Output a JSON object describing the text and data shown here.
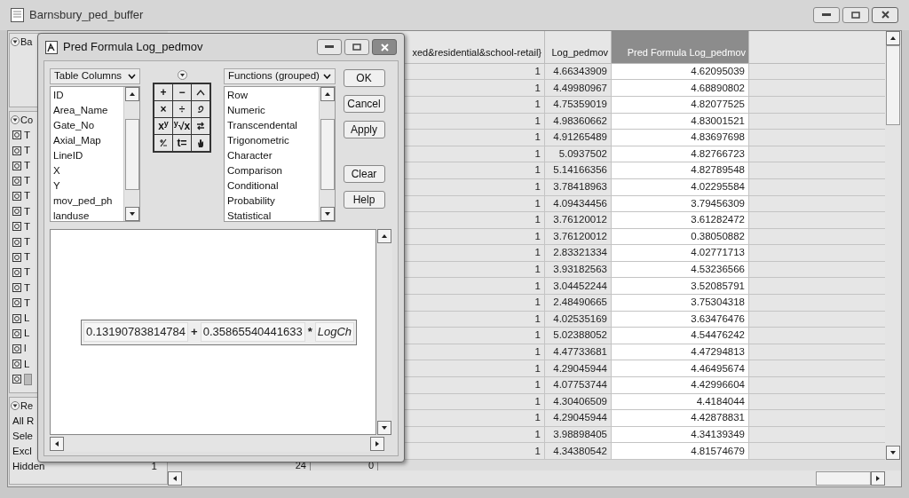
{
  "window": {
    "title": "Barnsbury_ped_buffer"
  },
  "left_panel": {
    "sections": [
      {
        "label": "Ba"
      },
      {
        "label": "Co"
      },
      {
        "label": "Re"
      }
    ],
    "columns": [
      {
        "label": "T"
      },
      {
        "label": "T"
      },
      {
        "label": "T"
      },
      {
        "label": "T"
      },
      {
        "label": "T"
      },
      {
        "label": "T"
      },
      {
        "label": "T"
      },
      {
        "label": "T"
      },
      {
        "label": "T"
      },
      {
        "label": "T"
      },
      {
        "label": "T"
      },
      {
        "label": "T"
      },
      {
        "label": "L"
      },
      {
        "label": "L"
      },
      {
        "label": "l"
      },
      {
        "label": "L"
      },
      {
        "kind": "formula"
      }
    ],
    "rows": [
      {
        "label": "All R"
      },
      {
        "label": "Sele"
      },
      {
        "label": "Excl"
      },
      {
        "label": "Hidden",
        "value": "1"
      }
    ]
  },
  "table": {
    "columns": [
      {
        "label": "xed&residential&school-retail}",
        "selected": false
      },
      {
        "label": "Log_pedmov",
        "selected": false
      },
      {
        "label": "Pred Formula Log_pedmov",
        "selected": true
      }
    ],
    "rows": [
      [
        "1",
        "4.66343909",
        "4.62095039"
      ],
      [
        "1",
        "4.49980967",
        "4.68890802"
      ],
      [
        "1",
        "4.75359019",
        "4.82077525"
      ],
      [
        "1",
        "4.98360662",
        "4.83001521"
      ],
      [
        "1",
        "4.91265489",
        "4.83697698"
      ],
      [
        "1",
        "5.0937502",
        "4.82766723"
      ],
      [
        "1",
        "5.14166356",
        "4.82789548"
      ],
      [
        "1",
        "3.78418963",
        "4.02295584"
      ],
      [
        "1",
        "4.09434456",
        "3.79456309"
      ],
      [
        "1",
        "3.76120012",
        "3.61282472"
      ],
      [
        "1",
        "3.76120012",
        "0.38050882"
      ],
      [
        "1",
        "2.83321334",
        "4.02771713"
      ],
      [
        "1",
        "3.93182563",
        "4.53236566"
      ],
      [
        "1",
        "3.04452244",
        "3.52085791"
      ],
      [
        "1",
        "2.48490665",
        "3.75304318"
      ],
      [
        "1",
        "4.02535169",
        "3.63476476"
      ],
      [
        "1",
        "5.02388052",
        "4.54476242"
      ],
      [
        "1",
        "4.47733681",
        "4.47294813"
      ],
      [
        "1",
        "4.29045944",
        "4.46495674"
      ],
      [
        "1",
        "4.07753744",
        "4.42996604"
      ],
      [
        "1",
        "4.30406509",
        "4.4184044"
      ],
      [
        "1",
        "4.29045944",
        "4.42878831"
      ],
      [
        "1",
        "3.98898405",
        "4.34139349"
      ],
      [
        "1",
        "4.34380542",
        "4.81574679"
      ]
    ],
    "summary": [
      "24",
      "0"
    ]
  },
  "dialog": {
    "title": "Pred Formula Log_pedmov",
    "columns_menu": "Table Columns",
    "columns_list": [
      "ID",
      "Area_Name",
      "Gate_No",
      "Axial_Map",
      "LineID",
      "X",
      "Y",
      "mov_ped_ph",
      "landuse"
    ],
    "functions_menu": "Functions (grouped)",
    "functions_list": [
      "Row",
      "Numeric",
      "Transcendental",
      "Trigonometric",
      "Character",
      "Comparison",
      "Conditional",
      "Probability",
      "Statistical"
    ],
    "keypad": [
      {
        "kind": "text",
        "label": "+"
      },
      {
        "kind": "text",
        "label": "−"
      },
      {
        "kind": "icon"
      },
      {
        "kind": "text",
        "label": "×"
      },
      {
        "kind": "text",
        "label": "÷"
      },
      {
        "kind": "icon"
      },
      {
        "kind": "text",
        "label": "x$^{y}$"
      },
      {
        "kind": "text",
        "label": "$^{y}$√x"
      },
      {
        "kind": "icon"
      },
      {
        "kind": "icon"
      },
      {
        "kind": "text",
        "label": "t="
      },
      {
        "kind": "icon"
      }
    ],
    "buttons": [
      {
        "label": "OK"
      },
      {
        "label": "Cancel"
      },
      {
        "label": "Apply"
      },
      {
        "label": "Clear"
      },
      {
        "label": "Help"
      }
    ],
    "formula": [
      {
        "kind": "number",
        "text": "0.13190783814784"
      },
      {
        "kind": "operator",
        "text": "+"
      },
      {
        "kind": "number",
        "text": "0.35865540441633"
      },
      {
        "kind": "operator",
        "text": "*"
      },
      {
        "kind": "column",
        "text": "LogCh"
      }
    ]
  }
}
